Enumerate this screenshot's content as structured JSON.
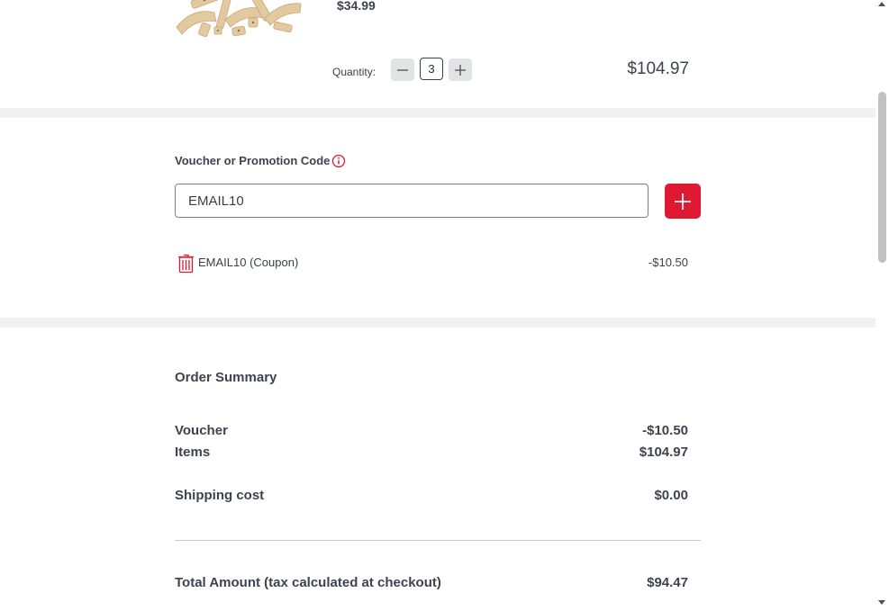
{
  "product": {
    "unit_price": "$34.99",
    "quantity_label": "Quantity:",
    "quantity": "3",
    "line_total": "$104.97",
    "image_icon": "wooden-track-pieces-image"
  },
  "voucher": {
    "title": "Voucher or Promotion Code",
    "info_icon": "info-icon",
    "input_value": "EMAIL10",
    "add_icon": "plus-icon",
    "applied": {
      "label": "EMAIL10 (Coupon)",
      "amount": "-$10.50",
      "remove_icon": "trash-icon"
    }
  },
  "summary": {
    "title": "Order Summary",
    "rows": [
      {
        "label": "Voucher",
        "value": "-$10.50"
      },
      {
        "label": "Items",
        "value": "$104.97"
      },
      {
        "label": "Shipping cost",
        "value": "$0.00"
      }
    ],
    "total_label": "Total Amount (tax calculated at checkout)",
    "total_value": "$94.47"
  },
  "colors": {
    "accent": "#e01933",
    "text": "#3d4450",
    "band": "#f1f1f1"
  }
}
